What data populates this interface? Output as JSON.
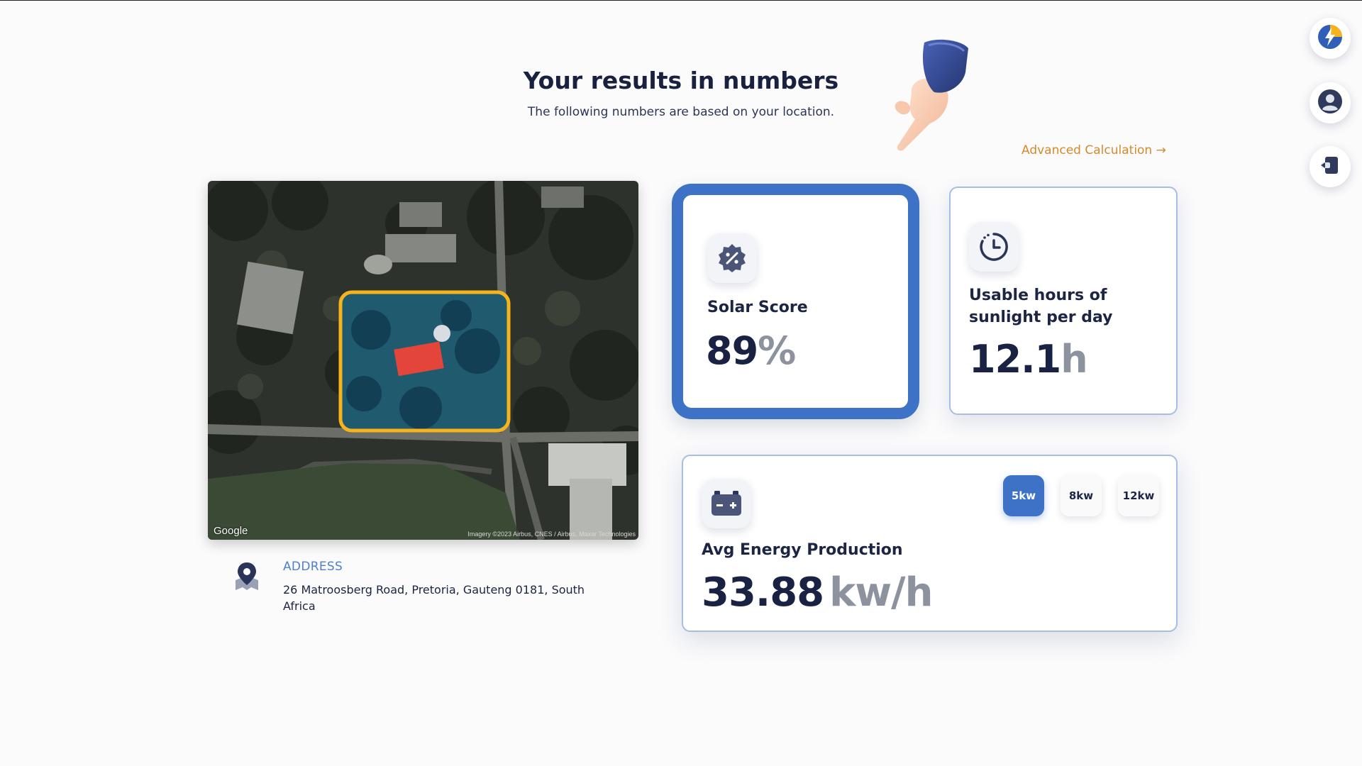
{
  "header": {
    "title": "Your results in numbers",
    "subtitle": "The following numbers are based on your location.",
    "advanced_link": "Advanced Calculation →"
  },
  "sidebar": {
    "items": [
      {
        "name": "solar-logo",
        "icon": "lightning-bolt-icon"
      },
      {
        "name": "profile",
        "icon": "user-icon"
      },
      {
        "name": "logout",
        "icon": "logout-icon"
      }
    ]
  },
  "map": {
    "google_label": "Google",
    "imagery_credit": "Imagery ©2023 Airbus, CNES / Airbus, Maxar Technologies",
    "highlight_color": "#f5b31c"
  },
  "address": {
    "label": "ADDRESS",
    "value": "26 Matroosberg Road, Pretoria, Gauteng 0181, South Africa",
    "icon": "map-pin-icon"
  },
  "cards": {
    "solar_score": {
      "label": "Solar Score",
      "value": "89",
      "unit": "%",
      "icon": "percent-badge-icon"
    },
    "sunlight": {
      "label": "Usable hours of sunlight per day",
      "value": "12.1",
      "unit": "h",
      "icon": "clock-icon"
    },
    "energy": {
      "label": "Avg Energy Production",
      "value": "33.88",
      "unit": "kw/h",
      "icon": "battery-icon",
      "options": [
        "5kw",
        "8kw",
        "12kw"
      ],
      "selected": "5kw"
    }
  },
  "colors": {
    "accent": "#3d72c6",
    "link": "#d6892a",
    "text": "#1d2545"
  }
}
